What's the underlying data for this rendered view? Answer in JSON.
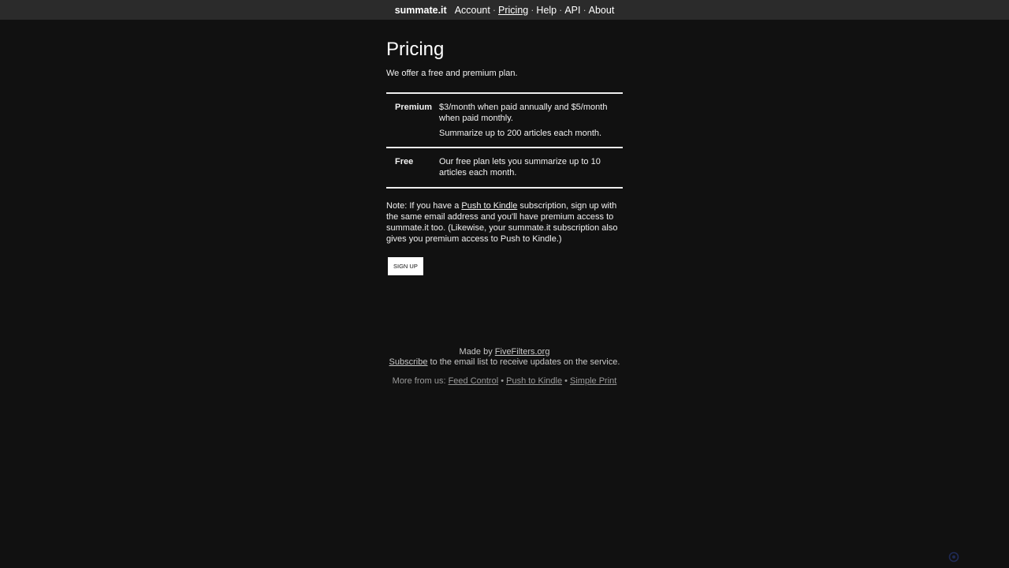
{
  "nav": {
    "brand": "summate.it",
    "links": [
      "Account",
      "Pricing",
      "Help",
      "API",
      "About"
    ],
    "separator": "·",
    "active": "Pricing"
  },
  "page": {
    "title": "Pricing",
    "intro": "We offer a free and premium plan."
  },
  "plans": [
    {
      "name": "Premium",
      "lines": [
        "$3/month when paid annually and $5/month when paid monthly.",
        "Summarize up to 200 articles each month."
      ]
    },
    {
      "name": "Free",
      "lines": [
        "Our free plan lets you summarize up to 10 articles each month."
      ]
    }
  ],
  "note": {
    "before": "Note: If you have a ",
    "link": "Push to Kindle",
    "after": " subscription, sign up with the same email address and you'll have premium access to summate.it too. (Likewise, your summate.it subscription also gives you premium access to Push to Kindle.)"
  },
  "signup_label": "SIGN UP",
  "footer": {
    "made_by_prefix": "Made by ",
    "made_by_link": "FiveFilters.org",
    "subscribe_link": "Subscribe",
    "subscribe_rest": " to the email list to receive updates on the service.",
    "more_prefix": "More from us: ",
    "more_links": [
      "Feed Control",
      "Push to Kindle",
      "Simple Print"
    ],
    "more_separator": " • "
  },
  "colors": {
    "background": "#111111",
    "navbar": "#2b2b2b",
    "text": "#f2f2f2",
    "button_bg": "#ffffff"
  },
  "icons": {
    "corner": "settings-gear-icon"
  }
}
